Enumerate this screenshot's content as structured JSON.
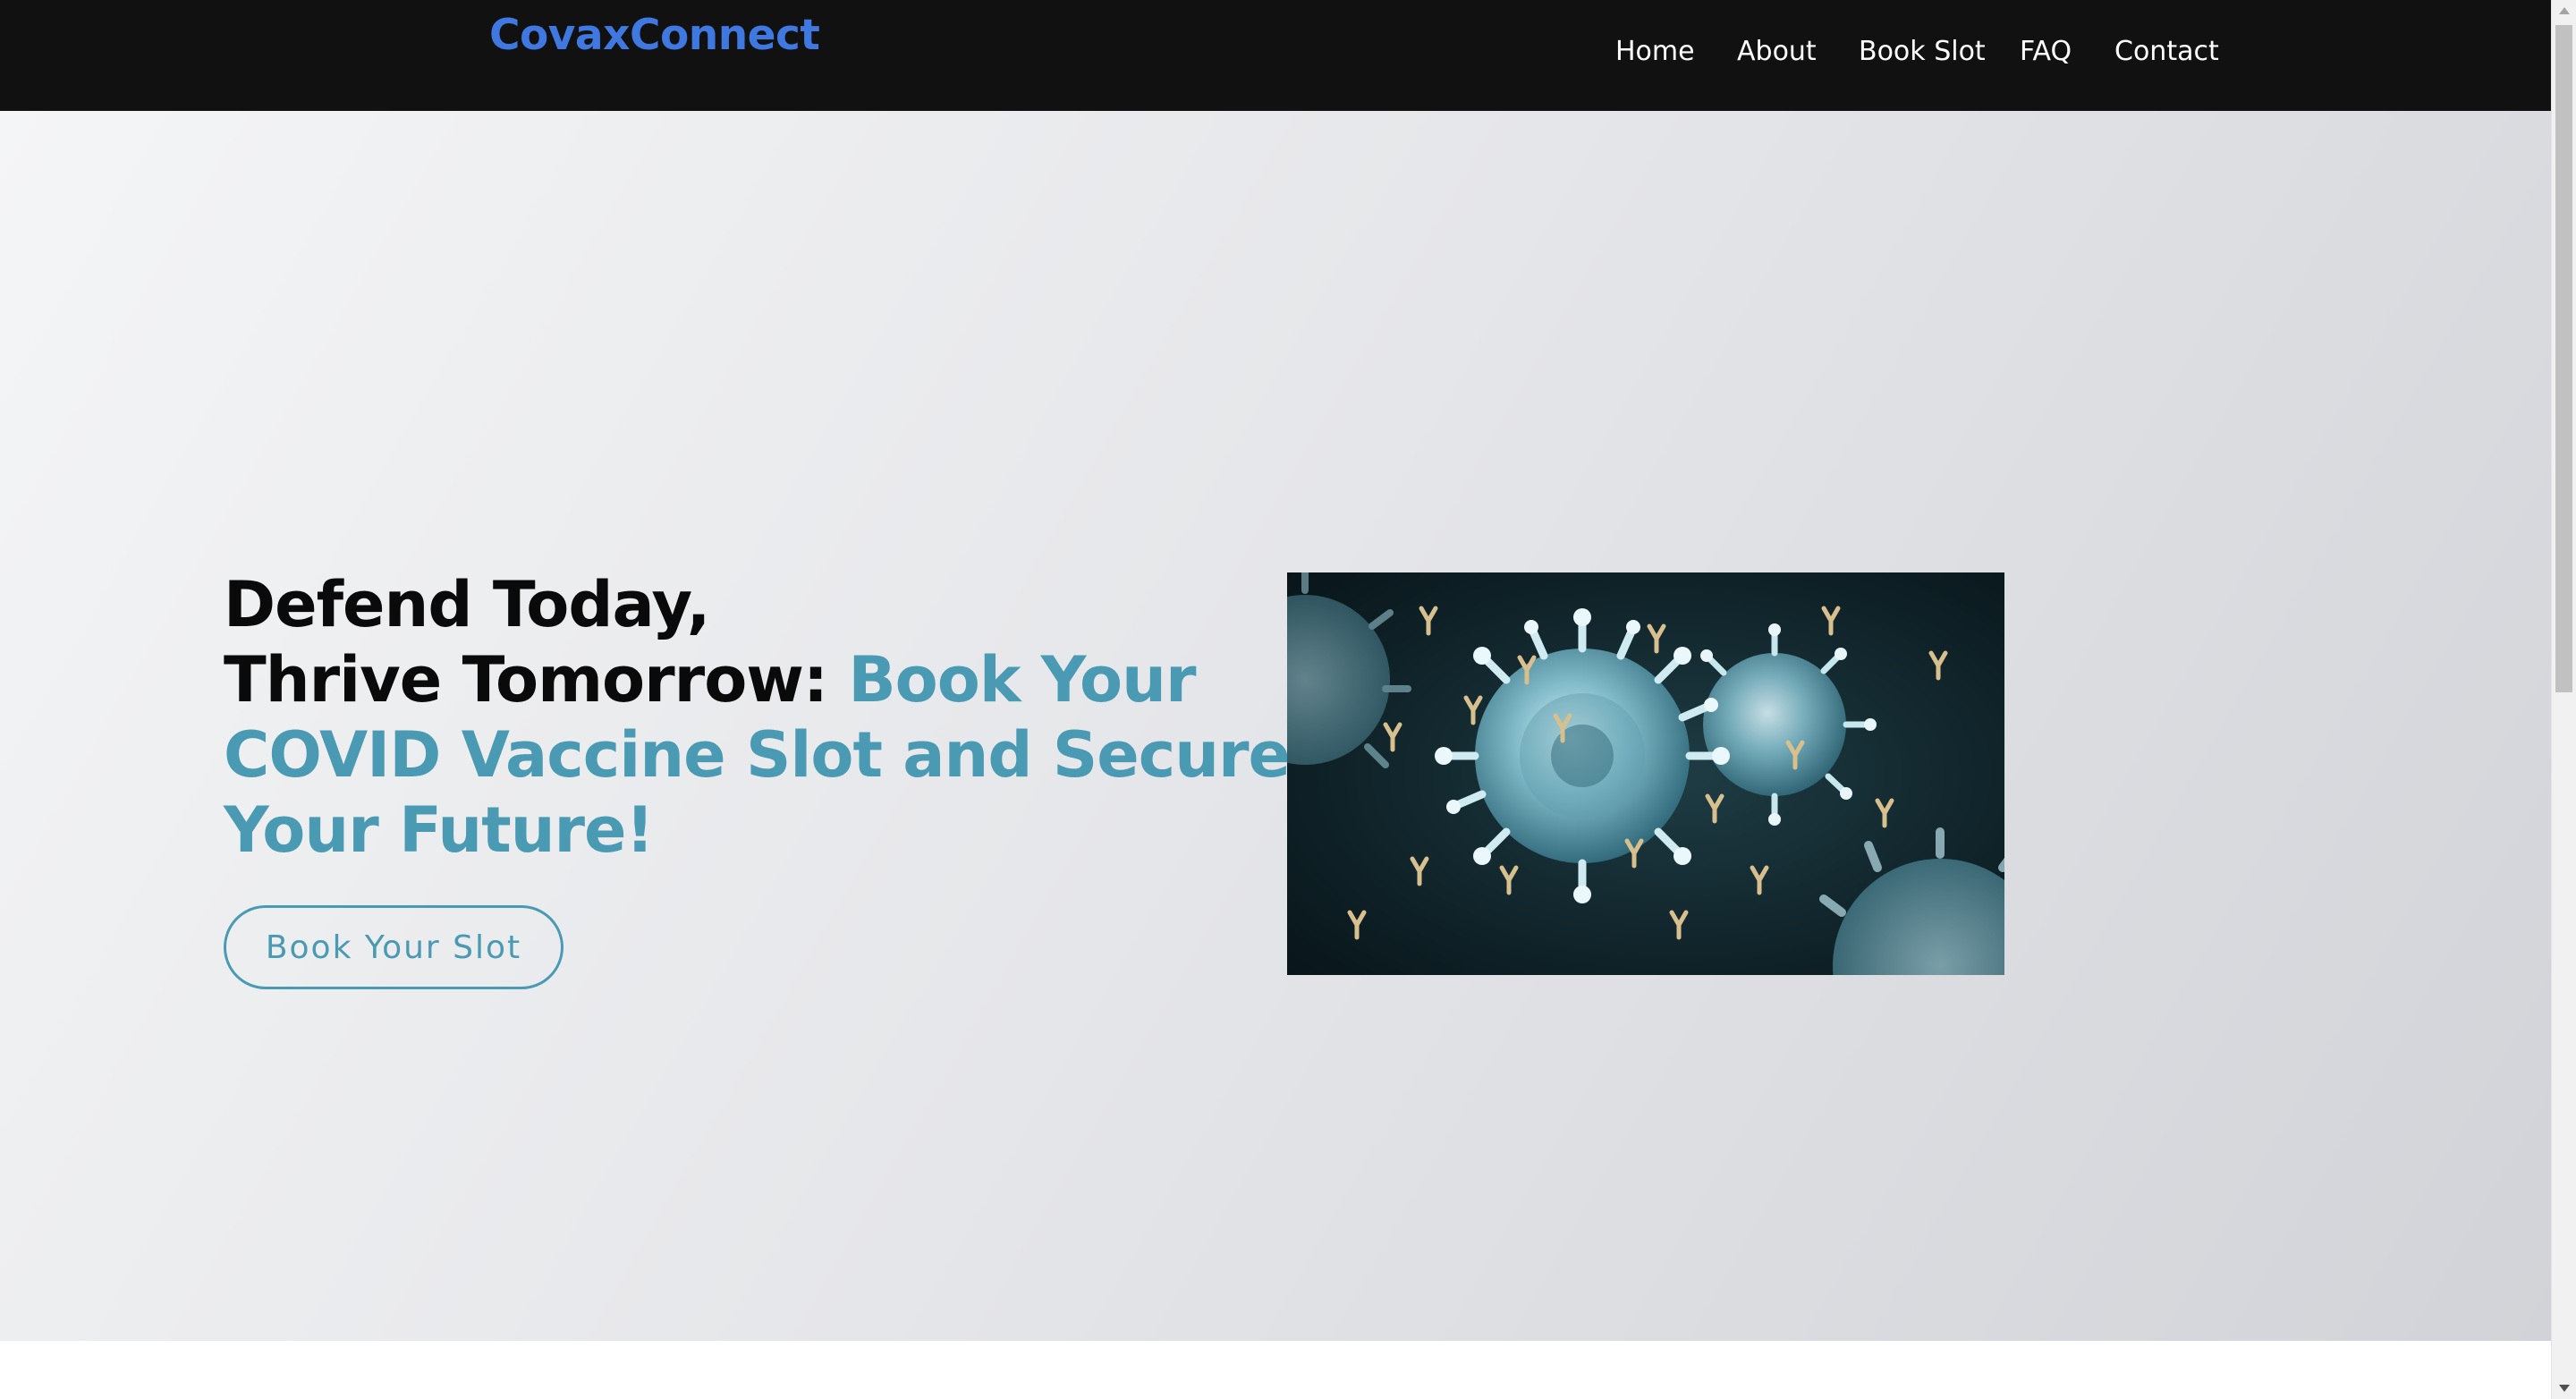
{
  "navbar": {
    "brand": "CovaxConnect",
    "links": [
      {
        "label": "Home"
      },
      {
        "label": "About"
      },
      {
        "label": "Book Slot"
      },
      {
        "label": "FAQ"
      },
      {
        "label": "Contact"
      }
    ]
  },
  "hero": {
    "title_line1": "Defend Today,",
    "title_line2": "Thrive Tomorrow:",
    "title_accent": "Book Your COVID Vaccine Slot and Secure Your Future!",
    "cta_label": "Book Your Slot",
    "image_subject": "coronavirus-particles-illustration"
  },
  "colors": {
    "brand": "#3f78e0",
    "accent": "#4a9ab3",
    "navbar_bg": "#111111",
    "heading": "#0a0a0a"
  }
}
